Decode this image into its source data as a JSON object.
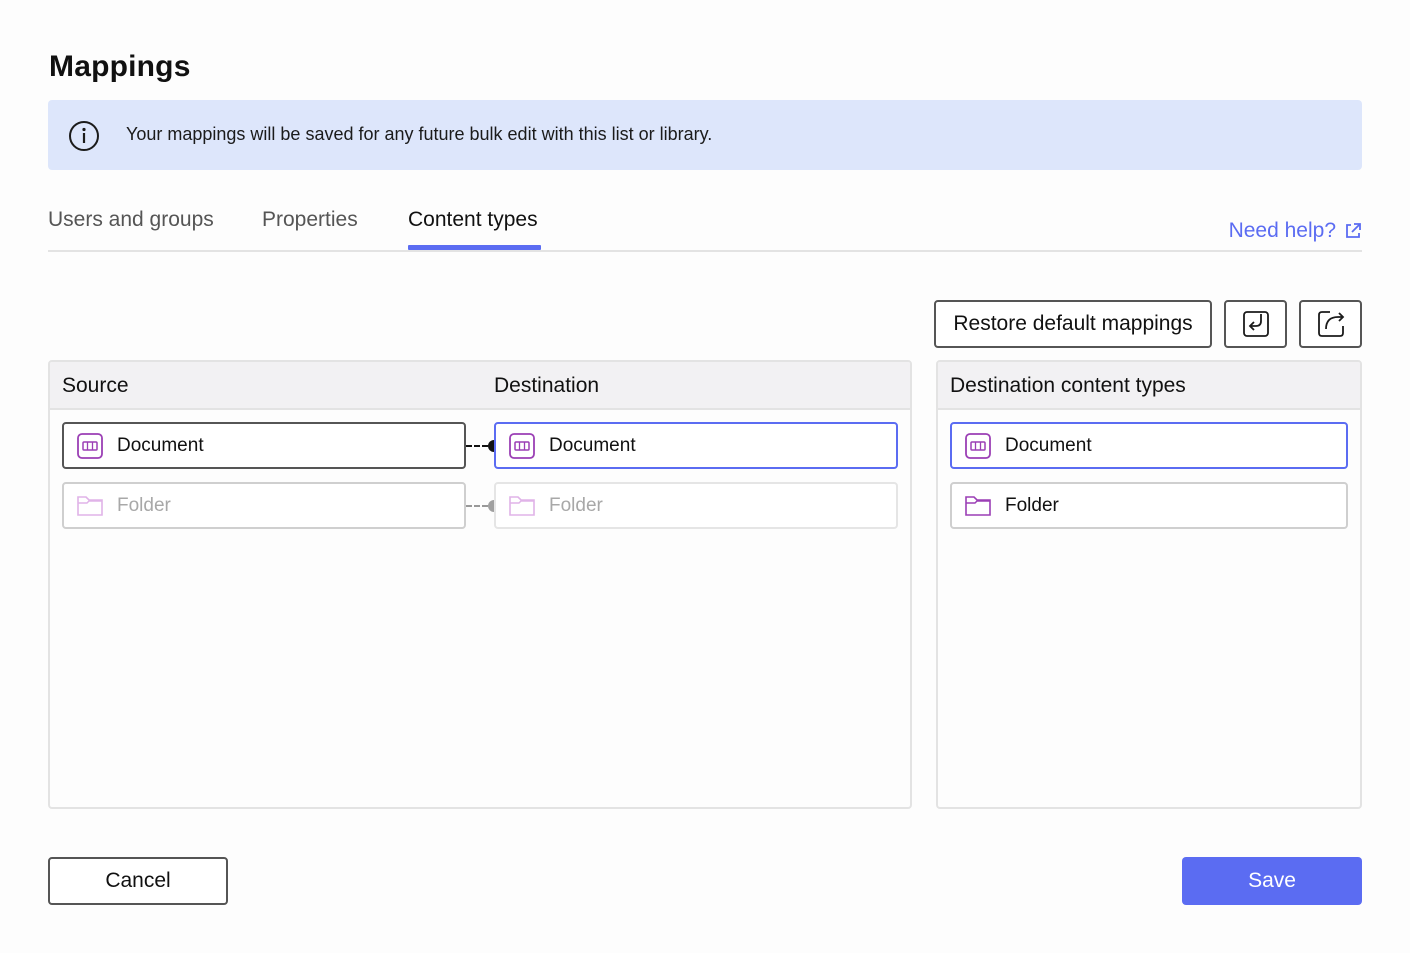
{
  "dialog": {
    "title": "Mappings",
    "banner_text": "Your mappings will be saved for any future bulk edit with this list or library."
  },
  "tabs": [
    {
      "label": "Users and groups",
      "active": false
    },
    {
      "label": "Properties",
      "active": false
    },
    {
      "label": "Content types",
      "active": true
    }
  ],
  "help": {
    "label": "Need help?"
  },
  "toolbar": {
    "restore_label": "Restore default mappings",
    "import_icon": "import-icon",
    "export_icon": "export-icon"
  },
  "mapping_panel": {
    "source_header": "Source",
    "destination_header": "Destination",
    "rows": [
      {
        "source": "Document",
        "destination": "Document",
        "enabled": true
      },
      {
        "source": "Folder",
        "destination": "Folder",
        "enabled": false
      }
    ]
  },
  "destination_types_panel": {
    "header": "Destination content types",
    "items": [
      {
        "label": "Document",
        "icon": "document-type-icon"
      },
      {
        "label": "Folder",
        "icon": "folder-icon"
      }
    ]
  },
  "footer": {
    "cancel_label": "Cancel",
    "save_label": "Save"
  },
  "colors": {
    "accent": "#5b6cf2",
    "banner_bg": "#dde6fb",
    "icon_purple": "#9b3fb5"
  }
}
